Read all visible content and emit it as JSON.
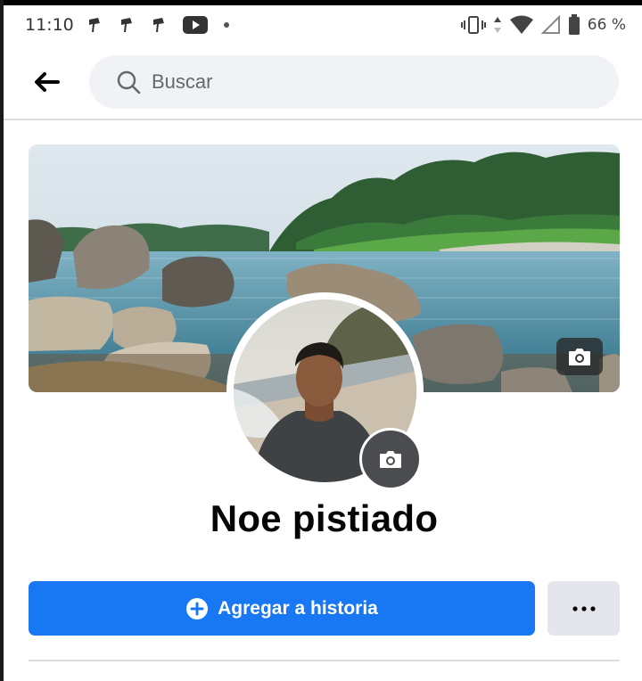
{
  "status_bar": {
    "time": "11:10",
    "battery": "66 %",
    "left_icons": [
      "notification-icon",
      "notification-icon",
      "notification-icon",
      "youtube-icon",
      "dot-icon"
    ],
    "right_icons": [
      "vibrate-icon",
      "data-arrows-icon",
      "wifi-icon",
      "signal-icon",
      "battery-icon"
    ]
  },
  "header": {
    "back_icon": "arrow-left-icon",
    "search_placeholder": "Buscar",
    "search_icon": "search-icon"
  },
  "profile": {
    "name": "Noe pistiado",
    "cover_icon": "camera-icon",
    "avatar_icon": "camera-icon"
  },
  "actions": {
    "add_story_label": "Agregar a historia",
    "add_story_icon": "plus-circle-icon",
    "more_icon": "more-dots-icon"
  },
  "colors": {
    "primary": "#1877f2",
    "secondary_button": "#e4e6eb",
    "search_bg": "#f0f2f5"
  }
}
